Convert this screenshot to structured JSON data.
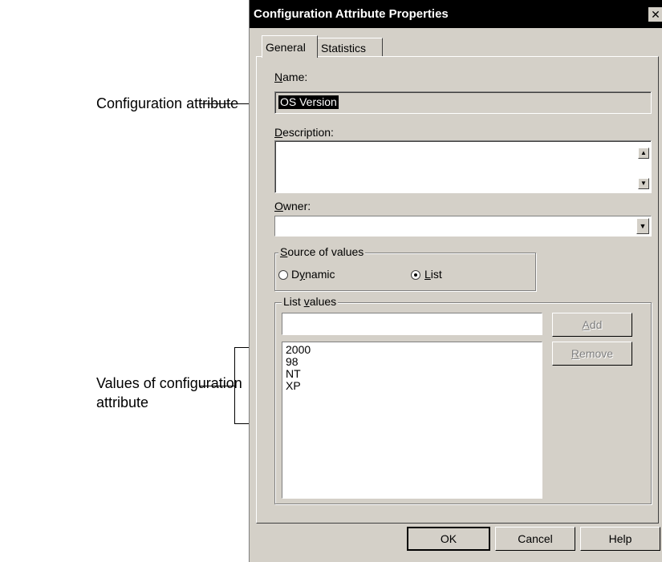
{
  "annotations": {
    "config_attribute": "Configuration attribute",
    "values_line1": "Values of configuration",
    "values_line2": "attribute"
  },
  "dialog": {
    "title": "Configuration Attribute Properties",
    "close_glyph": "✕",
    "tabs": [
      "General",
      "Statistics"
    ],
    "name_label": "Name:",
    "name_value": "OS Version",
    "description_label": "Description:",
    "description_value": "",
    "owner_label": "Owner:",
    "owner_value": "",
    "source_group": {
      "legend": "Source of values",
      "options": [
        "Dynamic",
        "List"
      ],
      "selected": "List"
    },
    "list_group": {
      "legend": "List values",
      "input_value": "",
      "items": [
        "2000",
        "98",
        "NT",
        "XP"
      ],
      "add_label": "Add",
      "remove_label": "Remove"
    },
    "ok_label": "OK",
    "cancel_label": "Cancel",
    "help_label": "Help"
  },
  "icons": [
    "close-icon",
    "scroll-up-icon",
    "scroll-down-icon",
    "dropdown-arrow-icon",
    "radio-icon"
  ]
}
